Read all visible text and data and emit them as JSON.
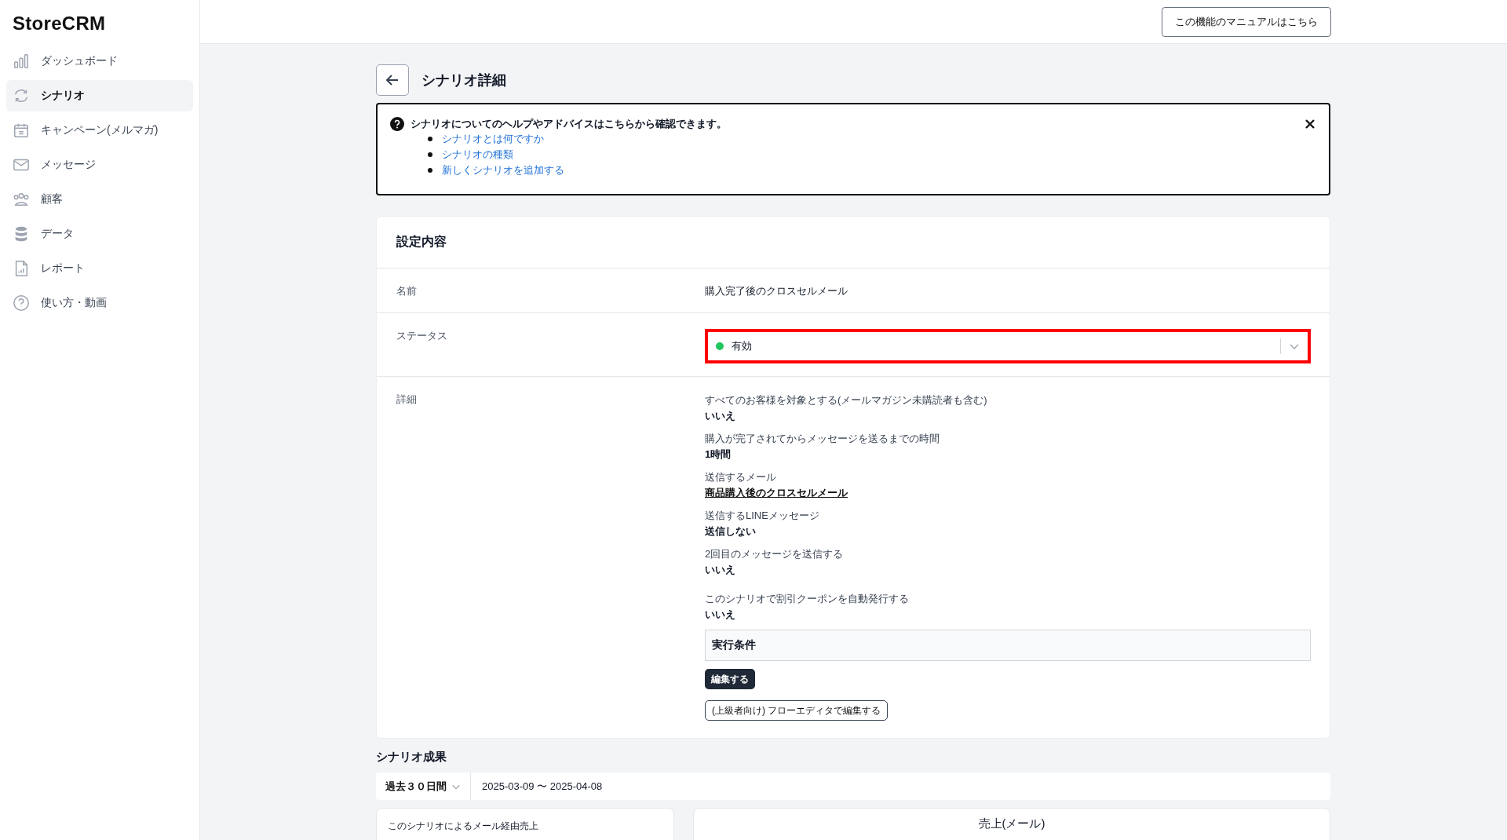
{
  "app": {
    "logo": "StoreCRM"
  },
  "sidebar": {
    "items": [
      {
        "label": "ダッシュボード",
        "selected": false
      },
      {
        "label": "シナリオ",
        "selected": true
      },
      {
        "label": "キャンペーン(メルマガ)",
        "selected": false
      },
      {
        "label": "メッセージ",
        "selected": false
      },
      {
        "label": "顧客",
        "selected": false
      },
      {
        "label": "データ",
        "selected": false
      },
      {
        "label": "レポート",
        "selected": false
      },
      {
        "label": "使い方・動画",
        "selected": false
      }
    ]
  },
  "header": {
    "manual_button": "この機能のマニュアルはこちら"
  },
  "page": {
    "title": "シナリオ詳細"
  },
  "help_box": {
    "text": "シナリオについてのヘルプやアドバイスはこちらから確認できます。",
    "links": [
      "シナリオとは何ですか",
      "シナリオの種類",
      "新しくシナリオを追加する"
    ]
  },
  "settings": {
    "title": "設定内容",
    "name": {
      "label": "名前",
      "value": "購入完了後のクロスセルメール"
    },
    "status": {
      "label": "ステータス",
      "value": "有効",
      "color": "#22c55e",
      "highlighted": true
    },
    "details": {
      "label": "詳細",
      "items": [
        {
          "label": "すべてのお客様を対象とする(メールマガジン未購読者も含む)",
          "value": "いいえ",
          "kind": "text"
        },
        {
          "label": "購入が完了されてからメッセージを送るまでの時間",
          "value": "1時間",
          "kind": "text"
        },
        {
          "label": "送信するメール",
          "value": "商品購入後のクロスセルメール",
          "kind": "link"
        },
        {
          "label": "送信するLINEメッセージ",
          "value": "送信しない",
          "kind": "text"
        },
        {
          "label": "2回目のメッセージを送信する",
          "value": "いいえ",
          "kind": "text"
        },
        {
          "label": "このシナリオで割引クーポンを自動発行する",
          "value": "いいえ",
          "kind": "text"
        }
      ],
      "conditions_title": "実行条件",
      "edit_button": "編集する",
      "flow_button": "(上級者向け) フローエディタで編集する"
    }
  },
  "results": {
    "title": "シナリオ成果",
    "period": "過去３０日間",
    "range": "2025-03-09 〜 2025-04-08",
    "card_1_title": "このシナリオによるメール経由売上",
    "card_2_title": "売上(メール)"
  }
}
